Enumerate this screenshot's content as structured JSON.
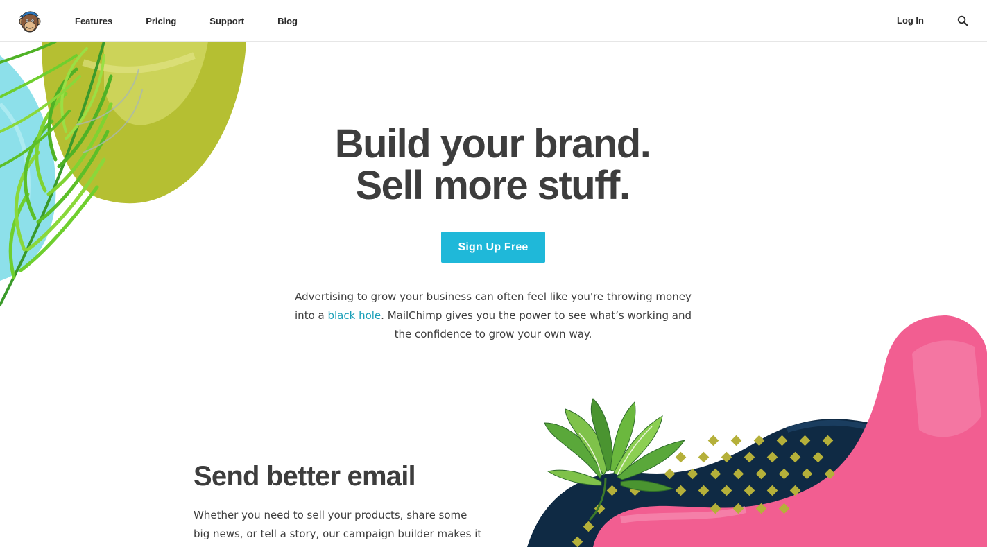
{
  "header": {
    "logo_label": "MailChimp",
    "nav": [
      {
        "label": "Features"
      },
      {
        "label": "Pricing"
      },
      {
        "label": "Support"
      },
      {
        "label": "Blog"
      }
    ],
    "login_label": "Log In",
    "search_icon": "search-icon"
  },
  "hero": {
    "title_line1": "Build your brand.",
    "title_line2": "Sell more stuff.",
    "cta_label": "Sign Up Free",
    "desc_part1": "Advertising to grow your business can often feel like you're throwing money into a ",
    "desc_link": "black hole",
    "desc_part2": ". MailChimp gives you the power to see what’s working and the confidence to grow your own way."
  },
  "email_section": {
    "heading": "Send better email",
    "body": "Whether you need to sell your products, share some big news, or tell a story, our campaign builder makes it"
  },
  "colors": {
    "accent": "#1fb8d9",
    "link": "#1a9fb8",
    "text": "#3d3d3d",
    "pink": "#f25e91",
    "navy": "#0f2a44",
    "olive": "#b5bf32",
    "cyan": "#8de0ea"
  }
}
